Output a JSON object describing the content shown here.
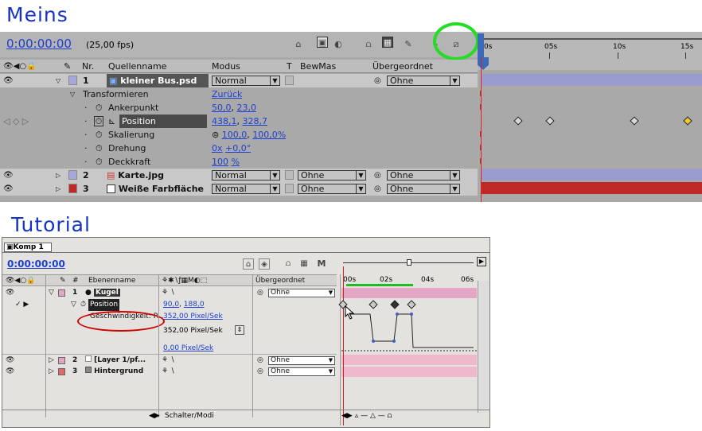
{
  "titles": {
    "mine": "Meins",
    "tutorial": "Tutorial"
  },
  "colors": {
    "accent_blue": "#1d3fcf",
    "highlight_green": "#22dd22",
    "cti_red": "#e02020",
    "layer_lavender": "#9a9cd0",
    "layer_red": "#c02828",
    "pink_bar": "#e3a6c4",
    "annotation_red": "#cc0000"
  },
  "mine": {
    "timecode": "0:00:00:00",
    "fps": "(25,00 fps)",
    "ruler": [
      "0s",
      "05s",
      "10s",
      "15s"
    ],
    "headers": {
      "nr": "Nr.",
      "name": "Quellenname",
      "mode": "Modus",
      "t": "T",
      "trkmat": "BewMas",
      "parent": "Übergeordnet"
    },
    "layer1": {
      "nr": "1",
      "name": "kleiner Bus.psd",
      "mode": "Normal",
      "parent": "Ohne"
    },
    "transform": {
      "label": "Transformieren",
      "reset": "Zurück"
    },
    "props": [
      {
        "name": "Ankerpunkt",
        "v1": "50,0",
        "v2": "23,0"
      },
      {
        "name": "Position",
        "v1": "438,1",
        "v2": "328,7"
      },
      {
        "name": "Skalierung",
        "v1": "100,0",
        "v2": "100,0%"
      },
      {
        "name": "Drehung",
        "v1": "0x",
        "v2": "+0,0°"
      },
      {
        "name": "Deckkraft",
        "v1": "100",
        "v2": "%"
      }
    ],
    "layer2": {
      "nr": "2",
      "name": "Karte.jpg",
      "mode": "Normal",
      "trkmat": "Ohne",
      "parent": "Ohne"
    },
    "layer3": {
      "nr": "3",
      "name": "Weiße Farbfläche",
      "mode": "Normal",
      "trkmat": "Ohne",
      "parent": "Ohne"
    },
    "comma": ","
  },
  "tutorial": {
    "tab": "Komp 1",
    "timecode": "0:00:00:00",
    "headers": {
      "hash": "#",
      "name": "Ebenenname",
      "parent": "Übergeordnet"
    },
    "ruler": [
      "00s",
      "02s",
      "04s",
      "06s"
    ],
    "layer1": {
      "nr": "1",
      "name": "Kugel",
      "parent": "Ohne"
    },
    "position": {
      "label": "Position",
      "v1": "90,0",
      "v2": "188,0"
    },
    "speed": {
      "label": "Geschwindigkeit: P...",
      "v": "352,00 Pixel/Sek",
      "v2": "352,00 Pixel/Sek",
      "v3": "0,00 Pixel/Sek"
    },
    "layer2": {
      "nr": "2",
      "name": "[Layer 1/pf...",
      "parent": "Ohne"
    },
    "layer3": {
      "nr": "3",
      "name": "Hintergrund",
      "parent": "Ohne"
    },
    "footer": "Schalter/Modi",
    "comma": ","
  }
}
